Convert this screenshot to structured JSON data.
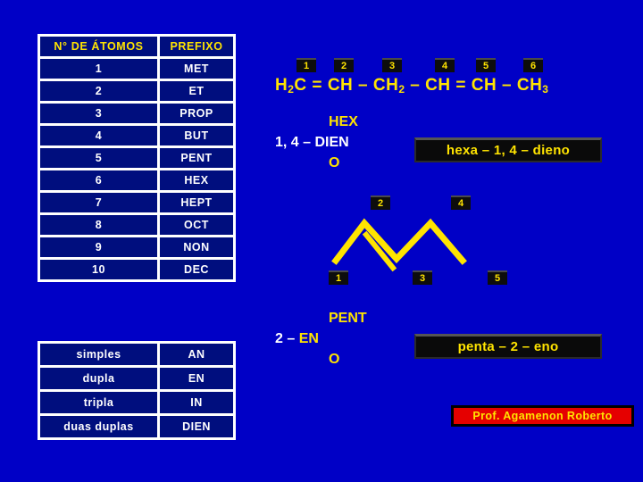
{
  "slide": {
    "background_color": "#0000c6",
    "accent_yellow": "#ffe400",
    "cell_color": "#000e7e"
  },
  "prefix_table": {
    "headers": [
      "N° DE ÁTOMOS",
      "PREFIXO"
    ],
    "rows": [
      {
        "atoms": "1",
        "prefix": "MET"
      },
      {
        "atoms": "2",
        "prefix": "ET"
      },
      {
        "atoms": "3",
        "prefix": "PROP"
      },
      {
        "atoms": "4",
        "prefix": "BUT"
      },
      {
        "atoms": "5",
        "prefix": "PENT"
      },
      {
        "atoms": "6",
        "prefix": "HEX"
      },
      {
        "atoms": "7",
        "prefix": "HEPT"
      },
      {
        "atoms": "8",
        "prefix": "OCT"
      },
      {
        "atoms": "9",
        "prefix": "NON"
      },
      {
        "atoms": "10",
        "prefix": "DEC"
      }
    ]
  },
  "bond_table": {
    "rows": [
      {
        "bond": "simples",
        "infix": "AN"
      },
      {
        "bond": "dupla",
        "infix": "EN"
      },
      {
        "bond": "tripla",
        "infix": "IN"
      },
      {
        "bond": "duas duplas",
        "infix": "DIEN"
      }
    ]
  },
  "example_one": {
    "chain_numbers": [
      "1",
      "2",
      "3",
      "4",
      "5",
      "6"
    ],
    "formula_parts": [
      {
        "text": "H",
        "sub": "2"
      },
      {
        "text": "C"
      },
      {
        "text": " = "
      },
      {
        "text": "CH"
      },
      {
        "text": " – "
      },
      {
        "text": "CH",
        "sub": "2"
      },
      {
        "text": " – "
      },
      {
        "text": "CH"
      },
      {
        "text": " = "
      },
      {
        "text": "CH"
      },
      {
        "text": " – "
      },
      {
        "text": "CH",
        "sub": "3"
      }
    ],
    "formula_plain": "H2C = CH – CH2 – CH = CH – CH3",
    "name_stack": {
      "root": "HEX",
      "locants": "1, 4 – ",
      "infix": "DIEN",
      "suffix": "O"
    },
    "callout": "hexa – 1, 4 – dieno"
  },
  "example_two": {
    "skeleton_numbers": [
      "1",
      "2",
      "3",
      "4",
      "5"
    ],
    "name_stack": {
      "root": "PENT",
      "locants": "2 – ",
      "infix": "EN",
      "suffix": "O"
    },
    "callout": "penta – 2 – eno"
  },
  "credit": {
    "text": "Prof. Agamenon Roberto"
  }
}
